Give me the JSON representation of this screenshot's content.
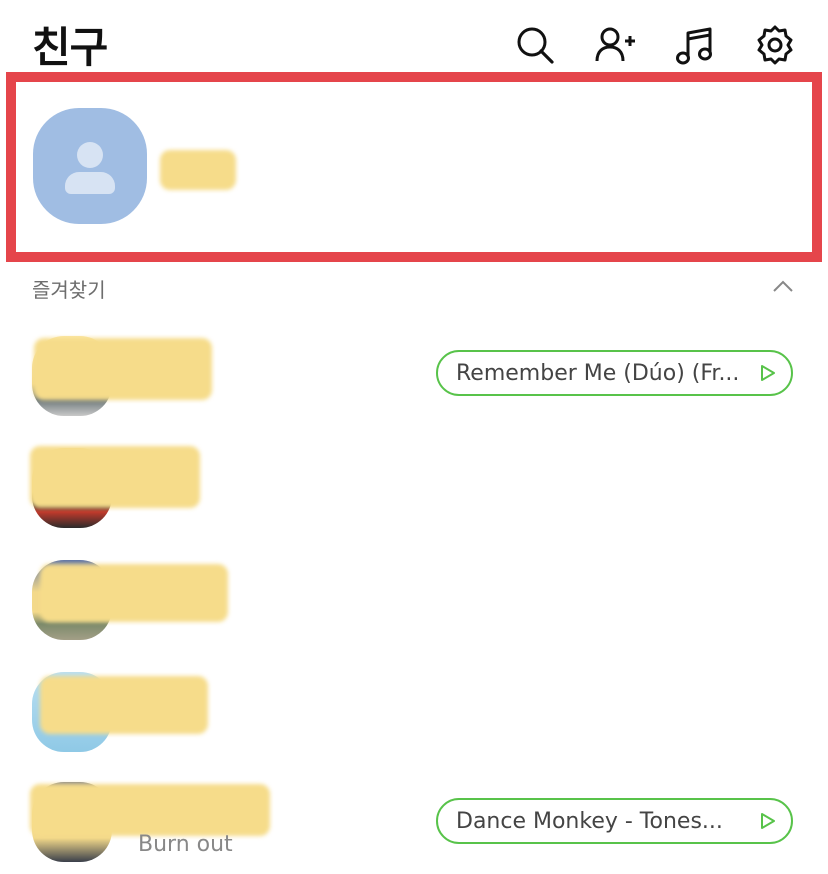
{
  "header": {
    "title": "친구",
    "icons": [
      "search-icon",
      "add-friend-icon",
      "music-icon",
      "settings-icon"
    ]
  },
  "profile": {
    "avatar": "default-person-icon",
    "highlight_color": "#e5454b"
  },
  "favorites": {
    "label": "즐겨찾기",
    "collapse_icon": "chevron-up-icon",
    "friends": [
      {
        "music": "Remember Me (Dúo) (Fr...",
        "status": ""
      },
      {
        "music": "",
        "status": ""
      },
      {
        "music": "",
        "status": ""
      },
      {
        "music": "",
        "status": ""
      },
      {
        "music": "Dance Monkey - Tones...",
        "status": "Burn out"
      }
    ]
  },
  "colors": {
    "music_pill": "#58c34a",
    "avatar_default": "#a0bde3"
  }
}
